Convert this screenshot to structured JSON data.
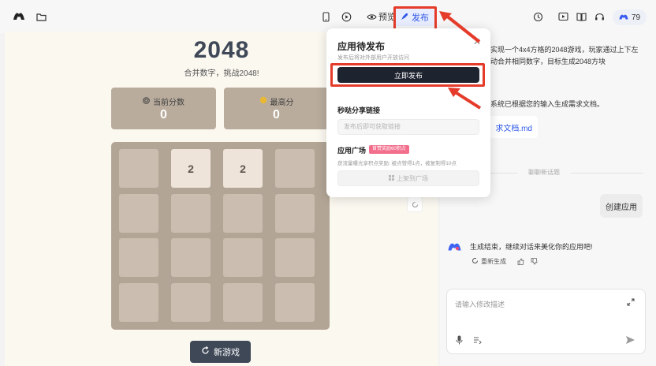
{
  "topbar": {
    "preview_label": "预览",
    "publish_label": "发布",
    "points": "79"
  },
  "game": {
    "title": "2048",
    "subtitle": "合并数字，挑战2048!",
    "current_score_label": "当前分数",
    "current_score": "0",
    "best_score_label": "最高分",
    "best_score": "0",
    "tiles": [
      "",
      "2",
      "2",
      "",
      "",
      "",
      "",
      "",
      "",
      "",
      "",
      "",
      "",
      "",
      "",
      ""
    ],
    "new_game_label": "新游戏"
  },
  "chat": {
    "intro_line1": "实现一个4x4方格的2048游戏，玩家通过上下左",
    "intro_line2": "动合并相同数字，目标生成2048方块",
    "doc_line": "系统已根据您的输入生成需求文档。",
    "file_chip": "求文档.md",
    "divider": "聊聊新话题",
    "user_message": "创建应用",
    "bot_message": "生成结束，继续对话来美化你的应用吧!",
    "regenerate_label": "重新生成",
    "input_placeholder": "请输入修改描述"
  },
  "popup": {
    "title": "应用待发布",
    "description": "发布后将对外部用户开放访问",
    "publish_now_label": "立即发布",
    "share_section": "秒哒分享链接",
    "share_placeholder": "发布后即可获取链接",
    "market_section": "应用广场",
    "market_badge": "首赞奖励60积点",
    "market_rule": "获流量曝光享积点奖励: 被点赞得1点，被复制得10点",
    "market_button": "上架到广场"
  },
  "colors": {
    "accent": "#2f57e6",
    "annotation_red": "#e53b2a",
    "board": "#b2a596",
    "tile_empty": "#cbbeb0",
    "tile_2": "#eee4da"
  }
}
